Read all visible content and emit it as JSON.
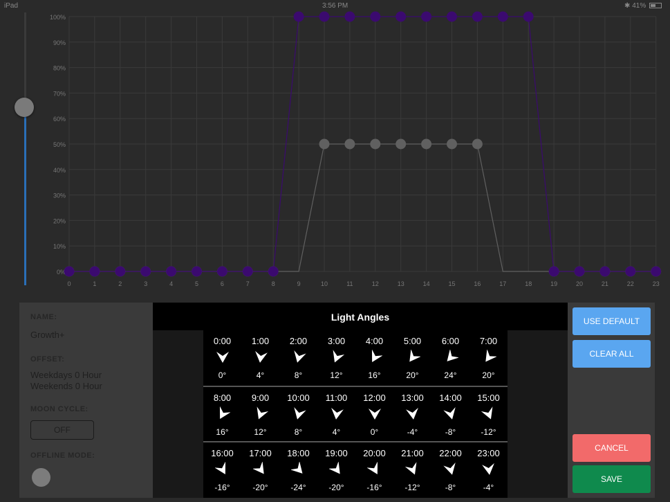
{
  "status_bar": {
    "device": "iPad",
    "time": "3:56 PM",
    "battery": "41%"
  },
  "chart_data": {
    "type": "line",
    "x": [
      0,
      1,
      2,
      3,
      4,
      5,
      6,
      7,
      8,
      9,
      10,
      11,
      12,
      13,
      14,
      15,
      16,
      17,
      18,
      19,
      20,
      21,
      22,
      23
    ],
    "y_ticks": [
      "0%",
      "10%",
      "20%",
      "30%",
      "40%",
      "50%",
      "60%",
      "70%",
      "80%",
      "90%",
      "100%"
    ],
    "ylim": [
      0,
      100
    ],
    "series": [
      {
        "color": "#3b0a6f",
        "values": [
          0,
          0,
          0,
          0,
          0,
          0,
          0,
          0,
          0,
          100,
          100,
          100,
          100,
          100,
          100,
          100,
          100,
          100,
          100,
          0,
          0,
          0,
          0,
          0
        ]
      },
      {
        "color": "#606060",
        "values": [
          0,
          0,
          0,
          0,
          0,
          0,
          0,
          0,
          0,
          0,
          50,
          50,
          50,
          50,
          50,
          50,
          50,
          0,
          0,
          0,
          0,
          0,
          0,
          0
        ]
      }
    ],
    "grid": true
  },
  "slider": {
    "level_fraction": 0.8
  },
  "info": {
    "name_label": "NAME:",
    "name_value": "Growth+",
    "offset_label": "OFFSET:",
    "offset_weekdays": "Weekdays 0 Hour",
    "offset_weekends": "Weekends 0 Hour",
    "moon_label": "MOON CYCLE:",
    "moon_value": "OFF",
    "offline_label": "OFFLINE MODE:"
  },
  "light_angles": {
    "title": "Light Angles",
    "cells": [
      {
        "time": "0:00",
        "deg": "0°",
        "angle": 0
      },
      {
        "time": "1:00",
        "deg": "4°",
        "angle": 4
      },
      {
        "time": "2:00",
        "deg": "8°",
        "angle": 8
      },
      {
        "time": "3:00",
        "deg": "12°",
        "angle": 12
      },
      {
        "time": "4:00",
        "deg": "16°",
        "angle": 16
      },
      {
        "time": "5:00",
        "deg": "20°",
        "angle": 20
      },
      {
        "time": "6:00",
        "deg": "24°",
        "angle": 24
      },
      {
        "time": "7:00",
        "deg": "20°",
        "angle": 20
      },
      {
        "time": "8:00",
        "deg": "16°",
        "angle": 16
      },
      {
        "time": "9:00",
        "deg": "12°",
        "angle": 12
      },
      {
        "time": "10:00",
        "deg": "8°",
        "angle": 8
      },
      {
        "time": "11:00",
        "deg": "4°",
        "angle": 4
      },
      {
        "time": "12:00",
        "deg": "0°",
        "angle": 0
      },
      {
        "time": "13:00",
        "deg": "-4°",
        "angle": -4
      },
      {
        "time": "14:00",
        "deg": "-8°",
        "angle": -8
      },
      {
        "time": "15:00",
        "deg": "-12°",
        "angle": -12
      },
      {
        "time": "16:00",
        "deg": "-16°",
        "angle": -16
      },
      {
        "time": "17:00",
        "deg": "-20°",
        "angle": -20
      },
      {
        "time": "18:00",
        "deg": "-24°",
        "angle": -24
      },
      {
        "time": "19:00",
        "deg": "-20°",
        "angle": -20
      },
      {
        "time": "20:00",
        "deg": "-16°",
        "angle": -16
      },
      {
        "time": "21:00",
        "deg": "-12°",
        "angle": -12
      },
      {
        "time": "22:00",
        "deg": "-8°",
        "angle": -8
      },
      {
        "time": "23:00",
        "deg": "-4°",
        "angle": -4
      }
    ]
  },
  "buttons": {
    "use_default": "USE DEFAULT",
    "clear_all": "CLEAR ALL",
    "cancel": "CANCEL",
    "save": "SAVE"
  }
}
